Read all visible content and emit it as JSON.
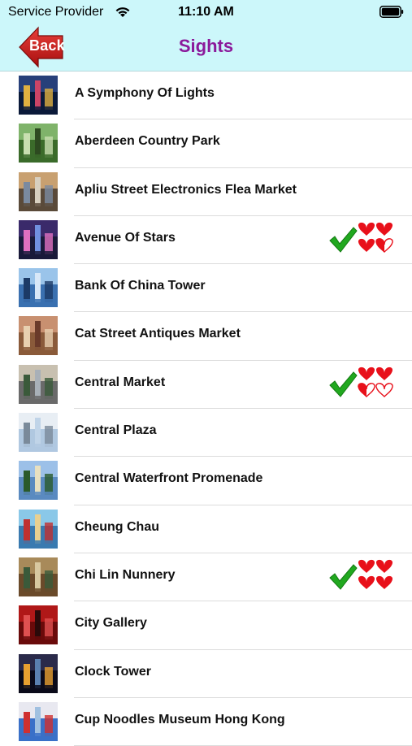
{
  "status_bar": {
    "carrier": "Service Provider",
    "time": "11:10 AM",
    "wifi_icon": "wifi-icon",
    "battery_icon": "battery-icon"
  },
  "nav": {
    "back_label": "Back",
    "title": "Sights",
    "title_color": "#8b1a9b",
    "back_color": "#d01a1a",
    "bar_color": "#ccf7fa"
  },
  "sights": [
    {
      "name": "A Symphony Of Lights",
      "visited": false
    },
    {
      "name": "Aberdeen Country Park",
      "visited": false
    },
    {
      "name": "Apliu Street Electronics Flea Market",
      "visited": false
    },
    {
      "name": "Avenue Of Stars",
      "visited": true,
      "hearts": 3.5
    },
    {
      "name": "Bank Of China Tower",
      "visited": false
    },
    {
      "name": "Cat Street Antiques Market",
      "visited": false
    },
    {
      "name": "Central Market",
      "visited": true,
      "hearts": 2.5
    },
    {
      "name": "Central Plaza",
      "visited": false
    },
    {
      "name": "Central Waterfront Promenade",
      "visited": false
    },
    {
      "name": "Cheung Chau",
      "visited": false
    },
    {
      "name": "Chi Lin Nunnery",
      "visited": true,
      "hearts": 4
    },
    {
      "name": "City Gallery",
      "visited": false
    },
    {
      "name": "Clock Tower",
      "visited": false
    },
    {
      "name": "Cup Noodles Museum Hong Kong",
      "visited": false
    }
  ]
}
